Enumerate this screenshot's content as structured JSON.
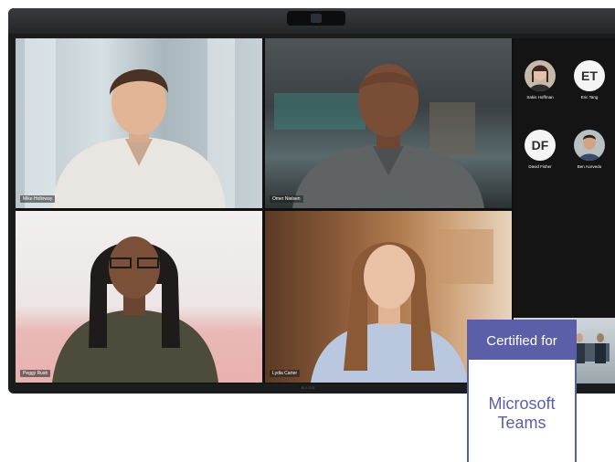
{
  "call": {
    "participants_grid": [
      {
        "name": "Mike Holloway"
      },
      {
        "name": "Omer Nielsen"
      },
      {
        "name": "Peggy Rush"
      },
      {
        "name": "Lydia Carter"
      }
    ],
    "sidebar": [
      {
        "name": "Sakis Hoffman",
        "initials": ""
      },
      {
        "name": "Eric Tang",
        "initials": "ET"
      },
      {
        "name": "David Fisher",
        "initials": "DF"
      },
      {
        "name": "Ben Acevedo",
        "initials": ""
      }
    ]
  },
  "device": {
    "bottom_label": "BYOD"
  },
  "badge": {
    "top": "Certified for",
    "line1": "Microsoft",
    "line2": "Teams",
    "color": "#5b5fa8"
  },
  "colors": {
    "bezel": "#1b1c1e",
    "screen": "#0f0f10"
  }
}
